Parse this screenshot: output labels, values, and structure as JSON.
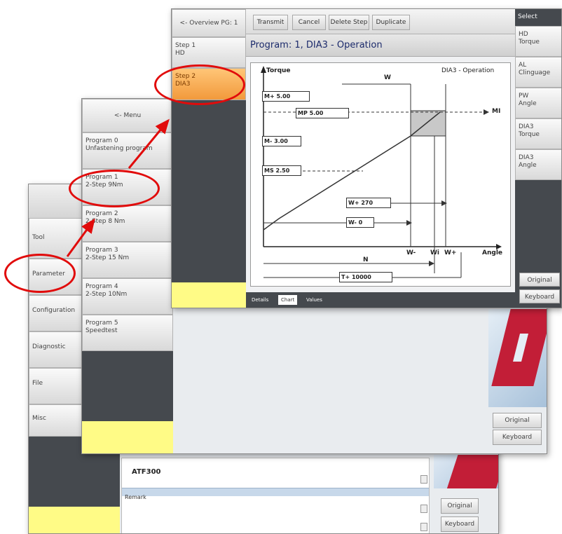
{
  "window_back": {
    "sidebar": [
      "Tool",
      "Parameter",
      "Configuration",
      "Diagnostic",
      "File",
      "Misc"
    ],
    "device_name": "ATF300",
    "section_label": "Remark",
    "right_buttons": [
      "Original",
      "Keyboard"
    ]
  },
  "window_mid": {
    "menu_button": "<- Menu",
    "programs": [
      {
        "title": "Program 0",
        "sub": "Unfastening program"
      },
      {
        "title": "Program 1",
        "sub": "2-Step 9Nm"
      },
      {
        "title": "Program 2",
        "sub": "2-Step 8 Nm"
      },
      {
        "title": "Program 3",
        "sub": "2-Step 15 Nm"
      },
      {
        "title": "Program 4",
        "sub": "2-Step 10Nm"
      },
      {
        "title": "Program 5",
        "sub": "Speedtest"
      }
    ],
    "right_buttons": [
      "Original",
      "Keyboard"
    ]
  },
  "window_front": {
    "overview_button": "<- Overview PG: 1",
    "steps": [
      {
        "title": "Step 1",
        "sub": "HD"
      },
      {
        "title": "Step 2",
        "sub": "DIA3"
      }
    ],
    "toolbar": [
      "Transmit",
      "Cancel",
      "Delete Step",
      "Duplicate"
    ],
    "title": "Program: 1, DIA3 - Operation",
    "select_header": "Select",
    "select_items": [
      {
        "l1": "HD",
        "l2": "Torque"
      },
      {
        "l1": "AL",
        "l2": "Clinguage"
      },
      {
        "l1": "PW",
        "l2": "Angle"
      },
      {
        "l1": "DIA3",
        "l2": "Torque"
      },
      {
        "l1": "DIA3",
        "l2": "Angle"
      }
    ],
    "right_buttons": [
      "Original",
      "Keyboard"
    ],
    "tabs": [
      "Details",
      "Chart",
      "Values"
    ],
    "chart": {
      "y_axis": "Torque",
      "x_axis": "Angle",
      "caption": "DIA3 - Operation",
      "labels": {
        "w_top": "W",
        "mi_right": "MI",
        "w_minus": "W-",
        "wi": "Wi",
        "w_plus": "W+",
        "n": "N"
      },
      "fields": [
        {
          "label": "M+",
          "value": "5.00"
        },
        {
          "label": "MP",
          "value": "5.00"
        },
        {
          "label": "M-",
          "value": "3.00"
        },
        {
          "label": "MS",
          "value": "2.50"
        },
        {
          "label": "W+",
          "value": "270"
        },
        {
          "label": "W-",
          "value": "0"
        },
        {
          "label": "T+",
          "value": "10000"
        }
      ]
    }
  },
  "colors": {
    "accent_orange": "#f7a24a",
    "highlight_red": "#e10b0b",
    "yellow": "#fffb86",
    "dark": "#45494e"
  }
}
